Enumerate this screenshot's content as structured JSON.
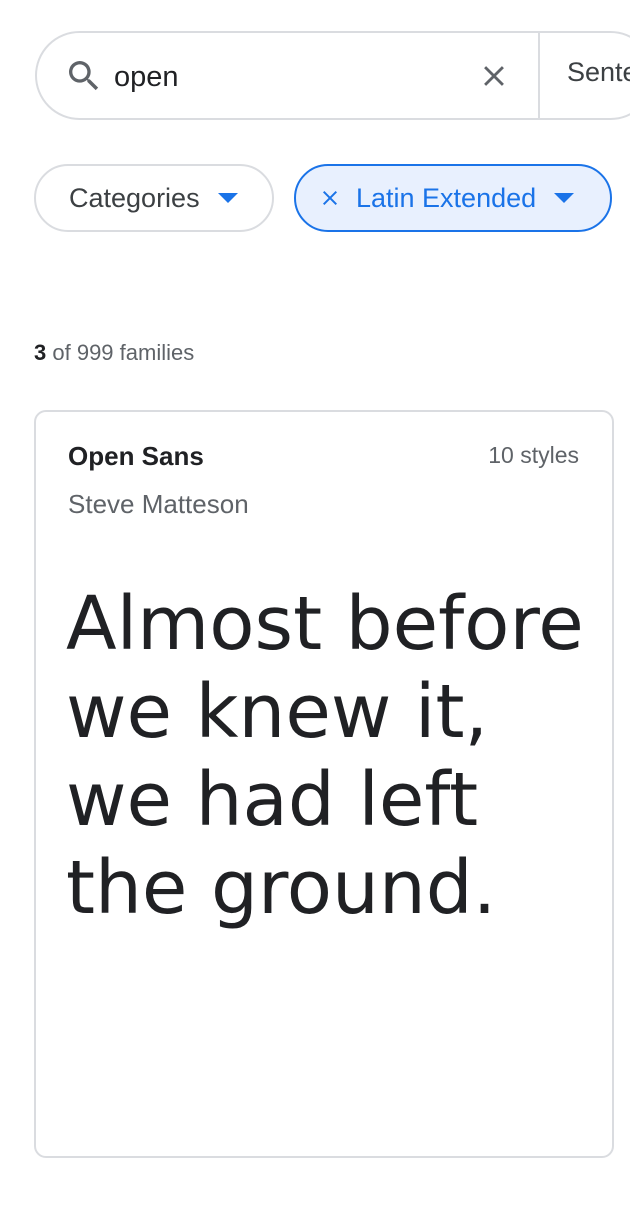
{
  "search": {
    "value": "open",
    "preview_mode_label": "Sente"
  },
  "filters": {
    "categories_label": "Categories",
    "active_filter_label": "Latin Extended"
  },
  "results": {
    "shown": "3",
    "rest": "of 999 families"
  },
  "font_card": {
    "family": "Open Sans",
    "styles": "10 styles",
    "designer": "Steve Matteson",
    "sample": "Almost before we knew it, we had left the ground."
  },
  "colors": {
    "accent": "#1a73e8",
    "chip_active_bg": "#e8f0fe",
    "border": "#dadce0"
  },
  "icons": [
    "search-icon",
    "close-icon",
    "chevron-down-icon"
  ]
}
